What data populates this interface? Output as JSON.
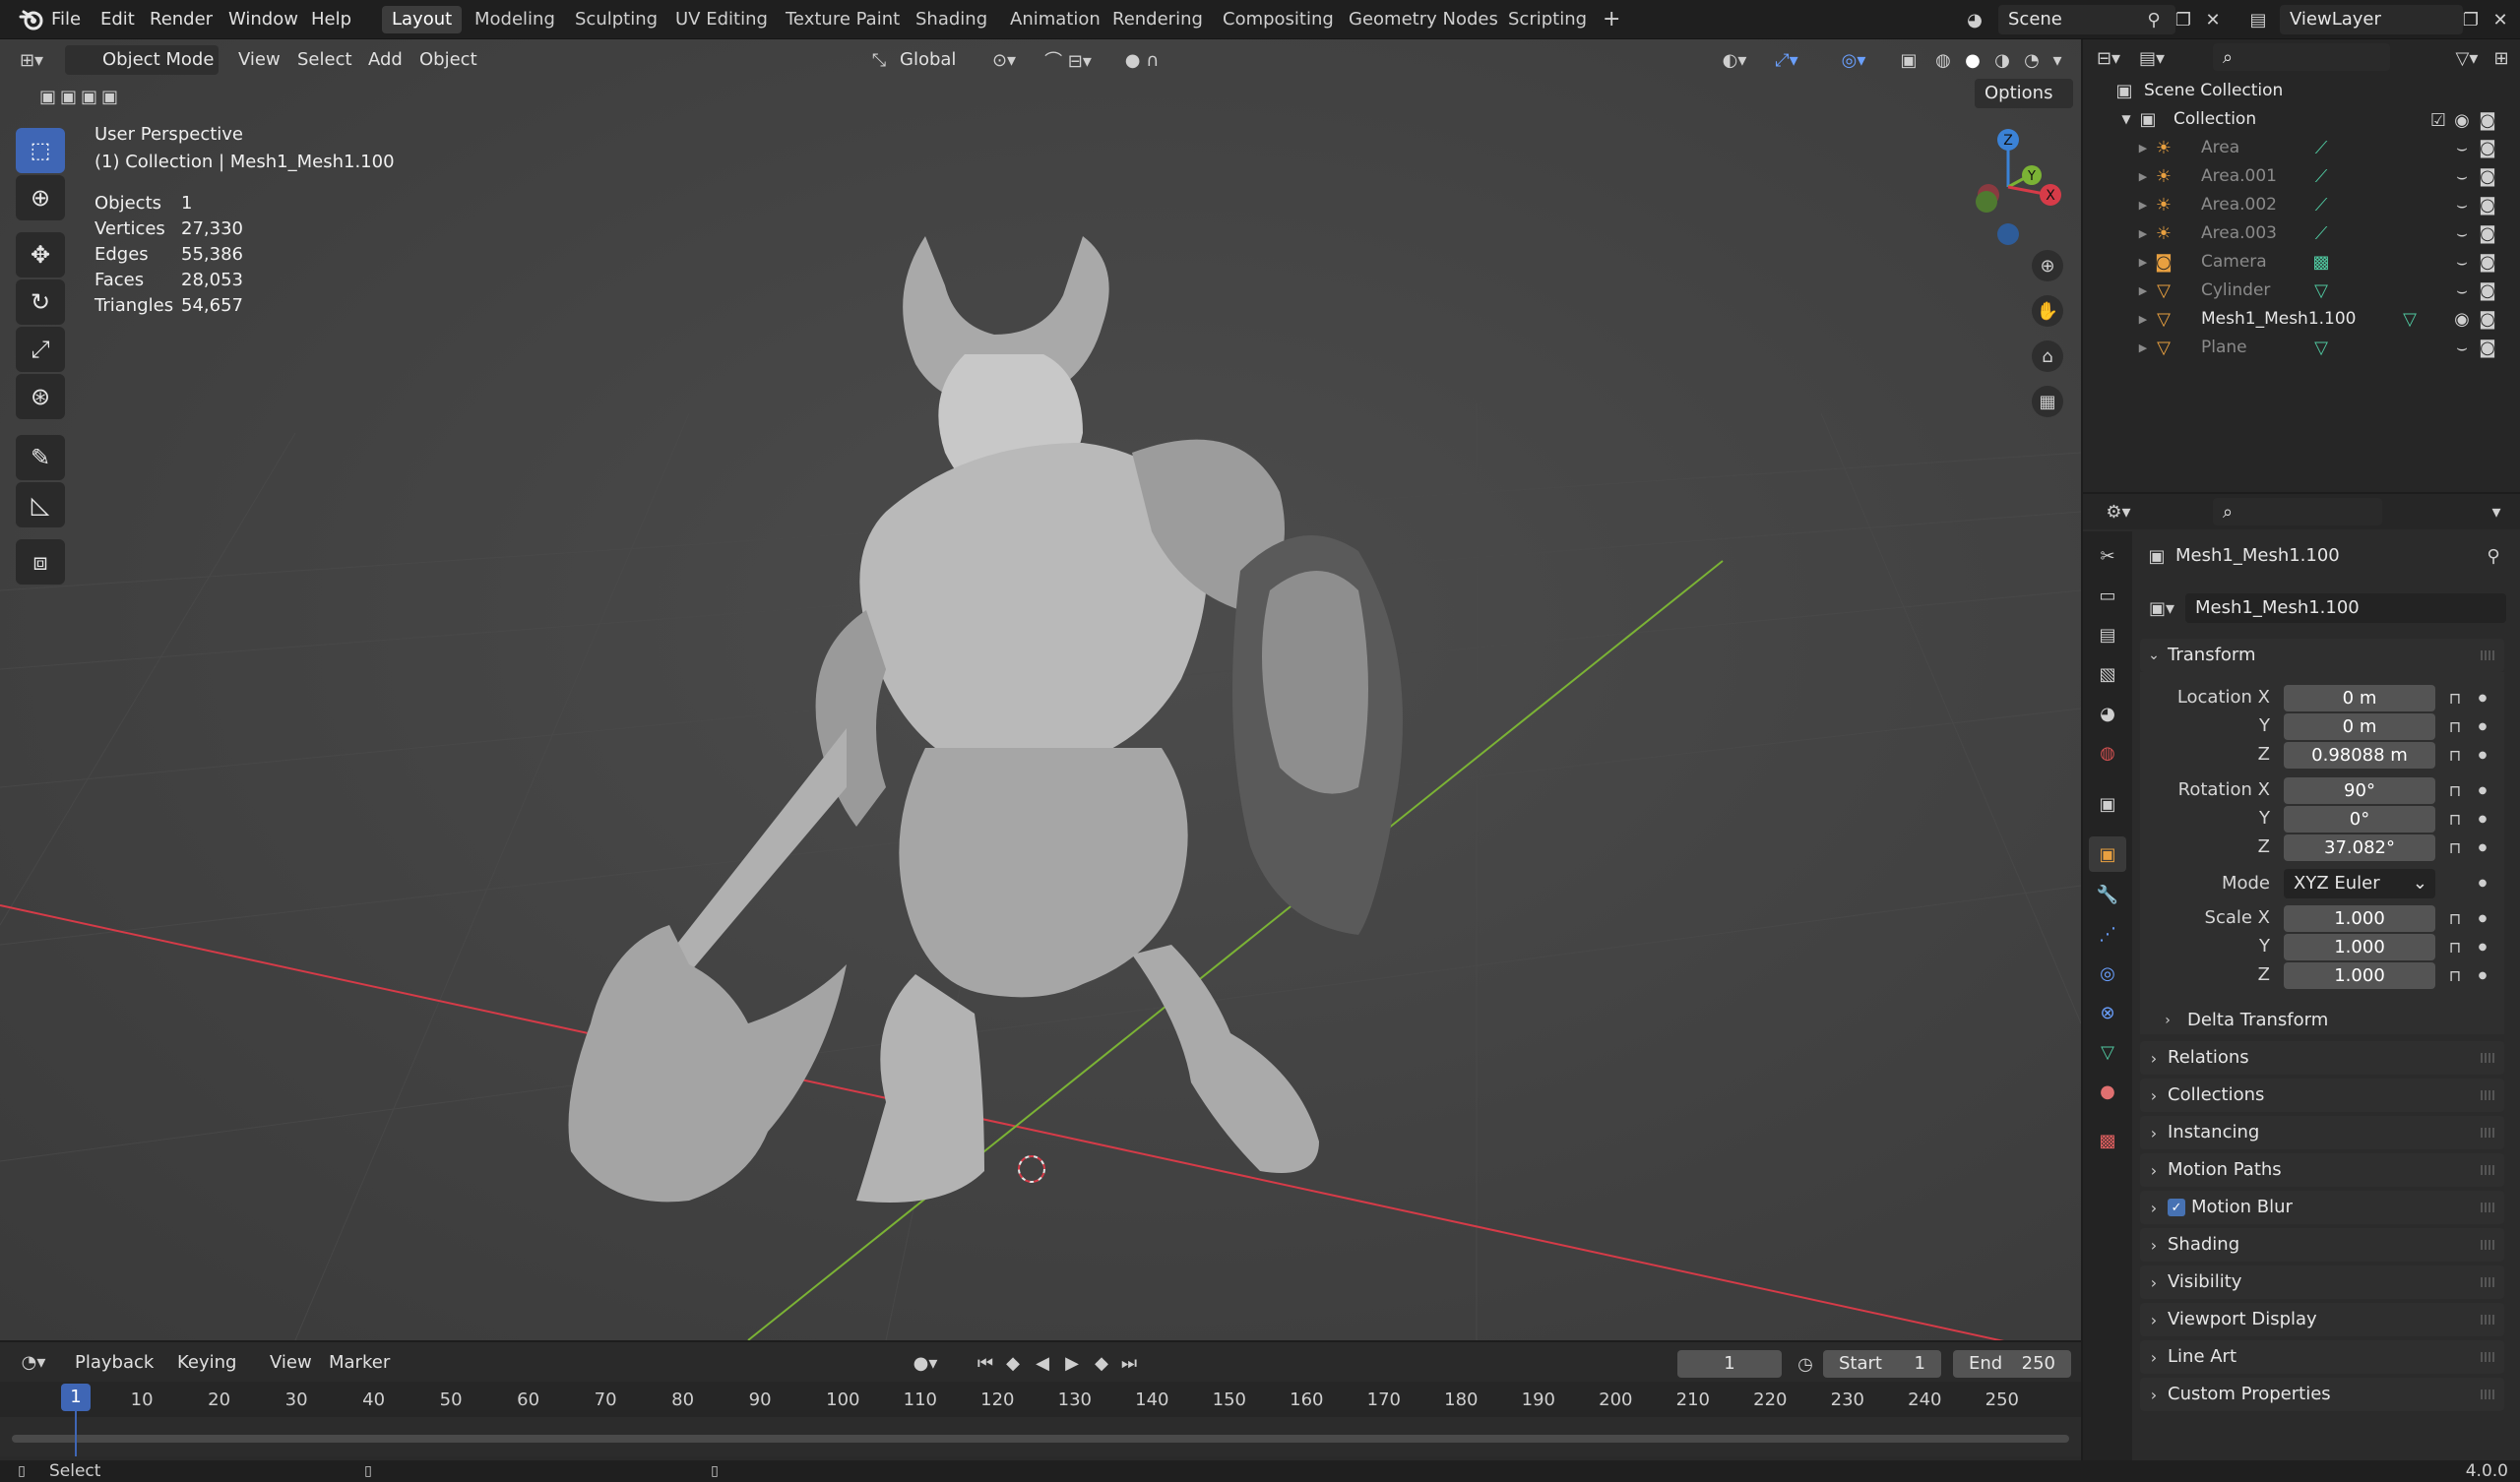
{
  "menu": {
    "items": [
      "File",
      "Edit",
      "Render",
      "Window",
      "Help"
    ],
    "workspaces": [
      "Layout",
      "Modeling",
      "Sculpting",
      "UV Editing",
      "Texture Paint",
      "Shading",
      "Animation",
      "Rendering",
      "Compositing",
      "Geometry Nodes",
      "Scripting"
    ],
    "active_workspace": "Layout",
    "add_workspace": "+",
    "scene_name": "Scene",
    "view_layer": "ViewLayer"
  },
  "viewport_header": {
    "mode": "Object Mode",
    "menus": [
      "View",
      "Select",
      "Add",
      "Object"
    ],
    "transform_orientation": "Global",
    "options_label": "Options"
  },
  "overlay": {
    "view_name": "User Perspective",
    "collection_info": "(1) Collection | Mesh1_Mesh1.100",
    "stats": [
      {
        "label": "Objects",
        "value": "1"
      },
      {
        "label": "Vertices",
        "value": "27,330"
      },
      {
        "label": "Edges",
        "value": "55,386"
      },
      {
        "label": "Faces",
        "value": "28,053"
      },
      {
        "label": "Triangles",
        "value": "54,657"
      }
    ]
  },
  "gizmo": {
    "z": "Z",
    "y": "Y",
    "x": "X"
  },
  "outliner": {
    "root": "Scene Collection",
    "collection": "Collection",
    "items": [
      {
        "name": "Area",
        "type": "light",
        "highlight": false
      },
      {
        "name": "Area.001",
        "type": "light",
        "highlight": false
      },
      {
        "name": "Area.002",
        "type": "light",
        "highlight": false
      },
      {
        "name": "Area.003",
        "type": "light",
        "highlight": false
      },
      {
        "name": "Camera",
        "type": "camera",
        "highlight": false
      },
      {
        "name": "Cylinder",
        "type": "mesh",
        "highlight": false
      },
      {
        "name": "Mesh1_Mesh1.100",
        "type": "mesh",
        "highlight": true
      },
      {
        "name": "Plane",
        "type": "mesh",
        "highlight": false
      }
    ]
  },
  "properties": {
    "object_name": "Mesh1_Mesh1.100",
    "datablock_name": "Mesh1_Mesh1.100",
    "transform_title": "Transform",
    "location": {
      "label": "Location X",
      "x": "0 m",
      "y": "0 m",
      "z": "0.98088 m"
    },
    "rotation": {
      "label": "Rotation X",
      "x": "90°",
      "y": "0°",
      "z": "37.082°"
    },
    "mode_label": "Mode",
    "mode_value": "XYZ Euler",
    "scale": {
      "label": "Scale X",
      "x": "1.000",
      "y": "1.000",
      "z": "1.000"
    },
    "axis_y": "Y",
    "axis_z": "Z",
    "delta_transform": "Delta Transform",
    "panels": [
      "Relations",
      "Collections",
      "Instancing",
      "Motion Paths",
      "Motion Blur",
      "Shading",
      "Visibility",
      "Viewport Display",
      "Line Art",
      "Custom Properties"
    ],
    "motion_blur_checked": true
  },
  "timeline": {
    "menus": [
      "Playback",
      "Keying",
      "View",
      "Marker"
    ],
    "current_frame": "1",
    "start_label": "Start",
    "start_value": "1",
    "end_label": "End",
    "end_value": "250",
    "ruler": [
      "1",
      "10",
      "20",
      "30",
      "40",
      "50",
      "60",
      "70",
      "80",
      "90",
      "100",
      "110",
      "120",
      "130",
      "140",
      "150",
      "160",
      "170",
      "180",
      "190",
      "200",
      "210",
      "220",
      "230",
      "240",
      "250"
    ]
  },
  "status": {
    "select_label": "Select",
    "version": "4.0.0"
  },
  "colors": {
    "accent_blue": "#3f66b5",
    "axis_x": "#d63b48",
    "axis_y": "#7bb335",
    "axis_z": "#3b82d6"
  }
}
